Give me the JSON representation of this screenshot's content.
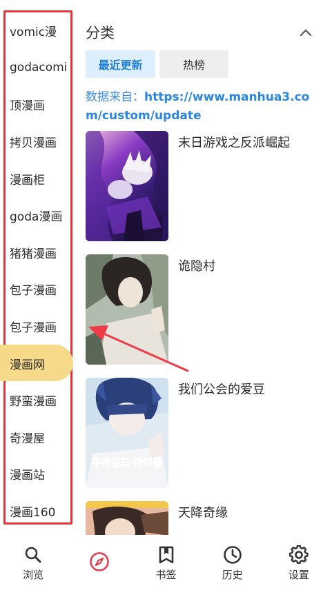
{
  "sidebar": {
    "items": [
      {
        "label": "vomic漫"
      },
      {
        "label": "godacomi"
      },
      {
        "label": "顶漫画"
      },
      {
        "label": "拷贝漫画"
      },
      {
        "label": "漫画柜"
      },
      {
        "label": "goda漫画"
      },
      {
        "label": "猪猪漫画"
      },
      {
        "label": "包子漫画"
      },
      {
        "label": "包子漫画"
      },
      {
        "label": "漫画网",
        "active": true
      },
      {
        "label": "野蛮漫画"
      },
      {
        "label": "奇漫屋"
      },
      {
        "label": "漫画站"
      },
      {
        "label": "漫画160"
      }
    ],
    "active_color": "#f7d98a",
    "highlight_frame_color": "#e8333a"
  },
  "main": {
    "section_title": "分类",
    "collapse_icon": "chevron-up-icon",
    "tabs": [
      {
        "label": "最近更新",
        "active": true
      },
      {
        "label": "热榜",
        "active": false
      }
    ],
    "source_prefix": "数据来自：",
    "source_url": "https://www.manhua3.com/custom/update",
    "manga": [
      {
        "title": "末日游戏之反派崛起"
      },
      {
        "title": "诡隐村"
      },
      {
        "title": "我们公会的爱豆",
        "cover_text": "우리길드 아이돌"
      },
      {
        "title": "天降奇缘"
      }
    ]
  },
  "bottom_nav": {
    "items": [
      {
        "label": "浏览",
        "icon": "search-icon"
      },
      {
        "label": "",
        "icon": "compass-icon",
        "active": true
      },
      {
        "label": "书签",
        "icon": "bookmark-icon"
      },
      {
        "label": "历史",
        "icon": "clock-icon"
      },
      {
        "label": "设置",
        "icon": "gear-icon"
      }
    ],
    "active_color": "#e23a4b"
  },
  "accent_color": "#1e7fd8"
}
